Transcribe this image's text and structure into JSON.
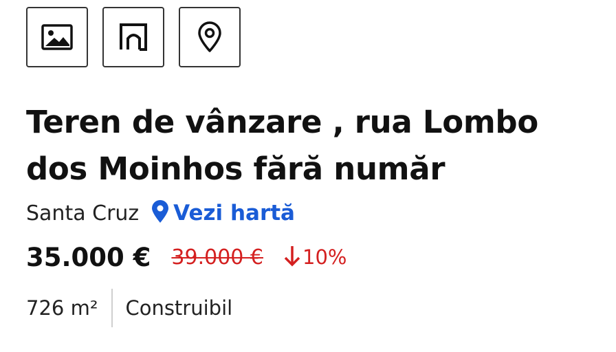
{
  "icons": {
    "photos": "image-icon",
    "plan": "floor-plan-icon",
    "map": "map-pin-icon",
    "map_link": "location-pin-icon",
    "price_drop": "arrow-down-icon"
  },
  "listing": {
    "title": "Teren de vânzare , rua Lombo dos Moinhos fără număr",
    "city": "Santa Cruz",
    "map_link_label": "Vezi hartă",
    "price": "35.000 €",
    "old_price": "39.000 €",
    "price_drop": "10%",
    "area": "726 m²",
    "land_type": "Construibil"
  },
  "colors": {
    "link": "#1a5cd6",
    "price_drop": "#d42020",
    "text": "#111111",
    "divider": "#cfcfcf"
  }
}
